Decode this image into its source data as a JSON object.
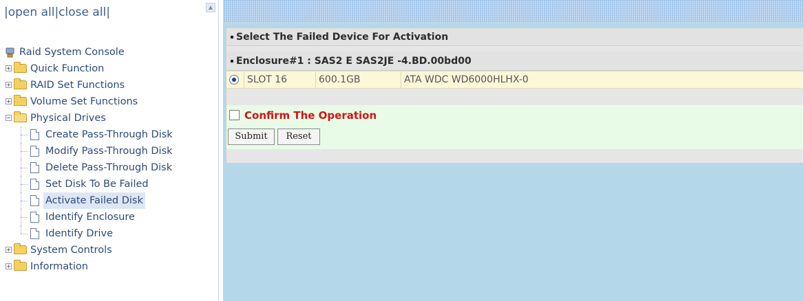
{
  "tree_header": {
    "prefix": "|",
    "open_all": "open all",
    "sep": "|",
    "close_all": "close all",
    "suffix": "|"
  },
  "tree": {
    "root": "Raid System Console",
    "folders": [
      {
        "label": "Quick Function",
        "expanded": false
      },
      {
        "label": "RAID Set Functions",
        "expanded": false
      },
      {
        "label": "Volume Set Functions",
        "expanded": false
      },
      {
        "label": "Physical Drives",
        "expanded": true
      },
      {
        "label": "System Controls",
        "expanded": false
      },
      {
        "label": "Information",
        "expanded": false
      }
    ],
    "physical_drives_items": [
      "Create Pass-Through Disk",
      "Modify Pass-Through Disk",
      "Delete Pass-Through Disk",
      "Set Disk To Be Failed",
      "Activate Failed Disk",
      "Identify Enclosure",
      "Identify Drive"
    ],
    "selected": "Activate Failed Disk"
  },
  "main": {
    "title": "Select The Failed Device For Activation",
    "enclosure": "Enclosure#1 : SAS2 E SAS2JE -4.BD.00bd00",
    "drive": {
      "slot": "SLOT 16",
      "capacity": "600.1GB",
      "model": "ATA WDC WD6000HLHX-0",
      "selected": true
    },
    "confirm_label": "Confirm The Operation",
    "confirm_checked": false,
    "submit_label": "Submit",
    "reset_label": "Reset"
  },
  "colors": {
    "accent_red": "#d21414",
    "banner": "#9fc2e8",
    "content_bg": "#b4d8ea"
  }
}
